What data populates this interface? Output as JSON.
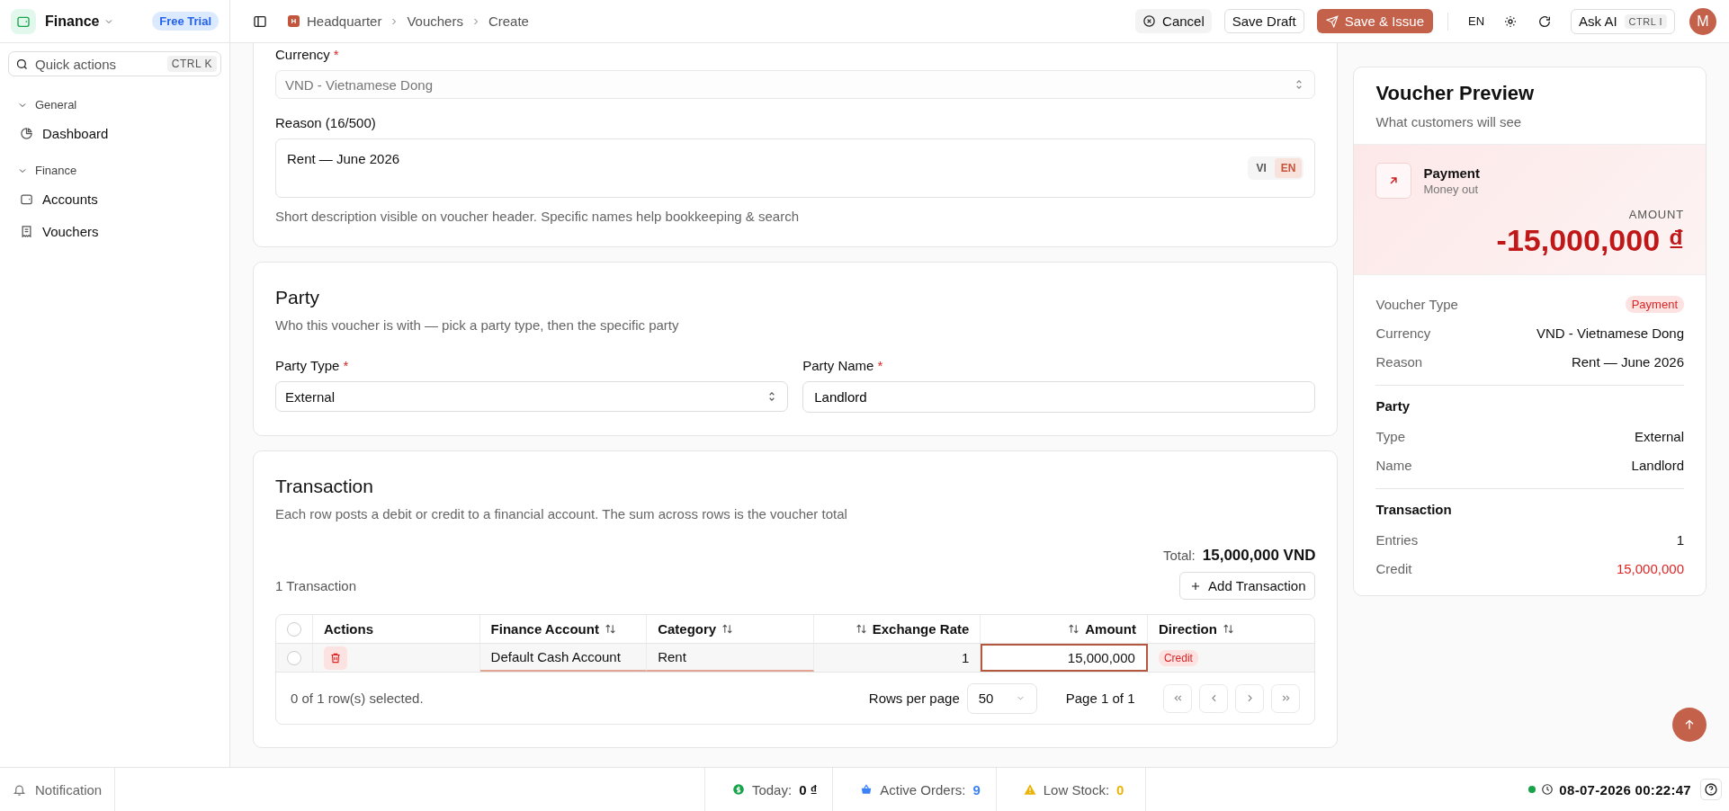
{
  "app": {
    "name": "Finance",
    "badge": "Free Trial"
  },
  "quick_actions": {
    "placeholder": "Quick actions",
    "shortcut": "CTRL K"
  },
  "sidebar": {
    "groups": [
      {
        "label": "General",
        "expanded": true,
        "items": [
          {
            "label": "Dashboard",
            "selected": false
          }
        ]
      },
      {
        "label": "Finance",
        "expanded": true,
        "items": [
          {
            "label": "Accounts",
            "selected": false
          },
          {
            "label": "Vouchers",
            "selected": false
          }
        ]
      }
    ]
  },
  "breadcrumb": {
    "badge": "H",
    "items": [
      "Headquarter",
      "Vouchers",
      "Create"
    ]
  },
  "toolbar": {
    "cancel": "Cancel",
    "save_draft": "Save Draft",
    "save_issue": "Save & Issue",
    "language": "EN",
    "ask_ai": "Ask AI",
    "ask_ai_shortcut": "CTRL I",
    "avatar": "M"
  },
  "general": {
    "currency": {
      "label": "Currency",
      "required_mark": "*",
      "value": "VND - Vietnamese Dong",
      "disabled": true
    },
    "reason": {
      "label": "Reason (16/500)",
      "value": "Rent — June 2026",
      "hint": "Short description visible on voucher header. Specific names help bookkeeping & search",
      "languages": [
        {
          "label": "VI",
          "selected": false
        },
        {
          "label": "EN",
          "selected": true
        }
      ]
    }
  },
  "party": {
    "title": "Party",
    "subtitle": "Who this voucher is with — pick a party type, then the specific party",
    "fields": [
      {
        "kind": "select",
        "label": "Party Type",
        "required_mark": "*",
        "value": "External"
      },
      {
        "kind": "input",
        "label": "Party Name",
        "required_mark": "*",
        "value": "Landlord"
      }
    ]
  },
  "transaction": {
    "title": "Transaction",
    "subtitle": "Each row posts a debit or credit to a financial account. The sum across rows is the voucher total",
    "total_label": "Total:",
    "total": "15,000,000 VND",
    "count": "1 Transaction",
    "add_button": "Add Transaction",
    "table": {
      "all_selected": false,
      "columns": [
        {
          "label": "Actions",
          "sortable": false,
          "numeric": false
        },
        {
          "label": "Finance Account",
          "sortable": true,
          "numeric": false
        },
        {
          "label": "Category",
          "sortable": true,
          "numeric": false
        },
        {
          "label": "Exchange Rate",
          "sortable": true,
          "numeric": true
        },
        {
          "label": "Amount",
          "sortable": true,
          "numeric": true
        },
        {
          "label": "Direction",
          "sortable": true,
          "numeric": false
        }
      ],
      "rows": [
        {
          "selected": false,
          "account": "Default Cash Account",
          "category": "Rent",
          "rate": "1",
          "amount": "15,000,000",
          "direction": "Credit"
        }
      ],
      "selection": "0 of 1 row(s) selected.",
      "rows_per_page_label": "Rows per page",
      "rows_per_page": "50",
      "page": "Page 1 of 1"
    }
  },
  "preview": {
    "title": "Voucher Preview",
    "subtitle": "What customers will see",
    "type": "Payment",
    "type_sub": "Money out",
    "amount_label": "AMOUNT",
    "amount": "-15,000,000 ₫",
    "details": [
      {
        "label": "Voucher Type",
        "value": "Payment",
        "kind": "badge"
      },
      {
        "label": "Currency",
        "value": "VND - Vietnamese Dong",
        "kind": "text"
      },
      {
        "label": "Reason",
        "value": "Rent — June 2026",
        "kind": "text"
      }
    ],
    "sections": [
      {
        "title": "Party",
        "rows": [
          {
            "label": "Type",
            "value": "External",
            "kind": "text"
          },
          {
            "label": "Name",
            "value": "Landlord",
            "kind": "text"
          }
        ]
      },
      {
        "title": "Transaction",
        "rows": [
          {
            "label": "Entries",
            "value": "1",
            "kind": "text"
          },
          {
            "label": "Credit",
            "value": "15,000,000",
            "kind": "credit"
          }
        ]
      }
    ]
  },
  "status_bar": {
    "notification": "Notification",
    "stats": [
      {
        "label": "Today:",
        "value": "0 ₫",
        "color": "#16a34a",
        "highlight": false
      },
      {
        "label": "Active Orders:",
        "value": "9",
        "color": "#3b82f6",
        "highlight": true
      },
      {
        "label": "Low Stock:",
        "value": "0",
        "color": "#eab308",
        "highlight": true
      }
    ],
    "online": true,
    "time": "08-07-2026 00:22:47"
  }
}
